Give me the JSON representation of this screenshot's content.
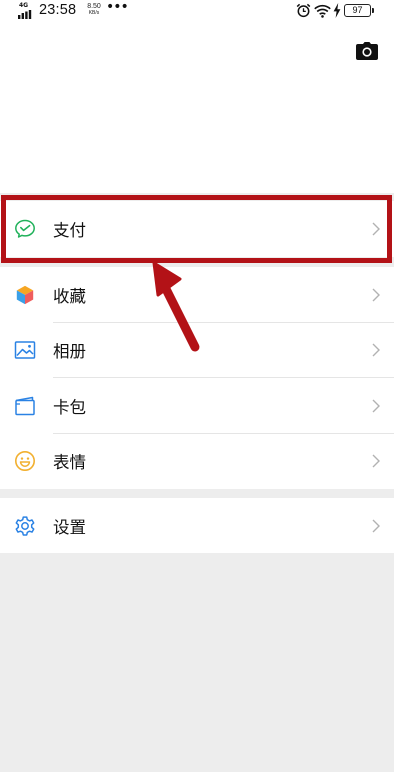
{
  "status_bar": {
    "network": "4G",
    "time": "23:58",
    "speed_value": "8.50",
    "speed_unit": "KB/s",
    "more": "•••",
    "battery": "97"
  },
  "header": {
    "camera_icon": "camera-icon"
  },
  "menu": {
    "group1": [
      {
        "label": "支付",
        "icon": "wechat-pay-icon",
        "color": "#20b15a"
      }
    ],
    "group2": [
      {
        "label": "收藏",
        "icon": "favorites-cube-icon",
        "color": "#f6a623"
      },
      {
        "label": "相册",
        "icon": "album-icon",
        "color": "#2a82e4"
      },
      {
        "label": "卡包",
        "icon": "card-wallet-icon",
        "color": "#2a82e4"
      },
      {
        "label": "表情",
        "icon": "sticker-smile-icon",
        "color": "#f2b030"
      }
    ],
    "group3": [
      {
        "label": "设置",
        "icon": "settings-gear-icon",
        "color": "#2a82e4"
      }
    ]
  },
  "annotation": {
    "highlight_color": "#b31217"
  }
}
